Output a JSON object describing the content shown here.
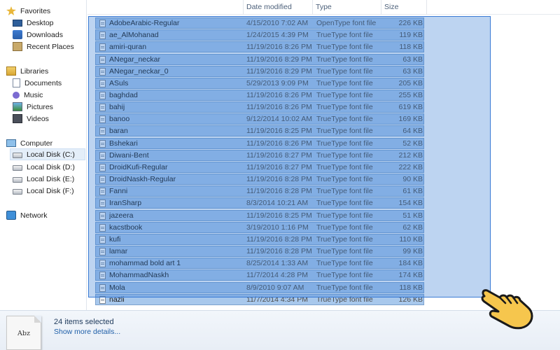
{
  "nav": {
    "favorites": {
      "label": "Favorites",
      "items": [
        "Desktop",
        "Downloads",
        "Recent Places"
      ]
    },
    "libraries": {
      "label": "Libraries",
      "items": [
        "Documents",
        "Music",
        "Pictures",
        "Videos"
      ]
    },
    "computer": {
      "label": "Computer",
      "items": [
        "Local Disk (C:)",
        "Local Disk (D:)",
        "Local Disk (E:)",
        "Local Disk (F:)"
      ],
      "selected": "Local Disk (C:)"
    },
    "network": {
      "label": "Network"
    }
  },
  "columns": {
    "name": "",
    "date": "Date modified",
    "type": "Type",
    "size": "Size"
  },
  "files": [
    {
      "name": "AdobeArabic-Regular",
      "date": "4/15/2010 7:02 AM",
      "type": "OpenType font file",
      "size": "226 KB",
      "selected": true
    },
    {
      "name": "ae_AlMohanad",
      "date": "1/24/2015 4:39 PM",
      "type": "TrueType font file",
      "size": "119 KB",
      "selected": true
    },
    {
      "name": "amiri-quran",
      "date": "11/19/2016 8:26 PM",
      "type": "TrueType font file",
      "size": "118 KB",
      "selected": true
    },
    {
      "name": "ANegar_neckar",
      "date": "11/19/2016 8:29 PM",
      "type": "TrueType font file",
      "size": "63 KB",
      "selected": true
    },
    {
      "name": "ANegar_neckar_0",
      "date": "11/19/2016 8:29 PM",
      "type": "TrueType font file",
      "size": "63 KB",
      "selected": true
    },
    {
      "name": "ASuls",
      "date": "5/29/2013 9:09 PM",
      "type": "TrueType font file",
      "size": "205 KB",
      "selected": true
    },
    {
      "name": "baghdad",
      "date": "11/19/2016 8:26 PM",
      "type": "TrueType font file",
      "size": "255 KB",
      "selected": true
    },
    {
      "name": "bahij",
      "date": "11/19/2016 8:26 PM",
      "type": "TrueType font file",
      "size": "619 KB",
      "selected": true
    },
    {
      "name": "banoo",
      "date": "9/12/2014 10:02 AM",
      "type": "TrueType font file",
      "size": "169 KB",
      "selected": true
    },
    {
      "name": "baran",
      "date": "11/19/2016 8:25 PM",
      "type": "TrueType font file",
      "size": "64 KB",
      "selected": true
    },
    {
      "name": "Bshekari",
      "date": "11/19/2016 8:26 PM",
      "type": "TrueType font file",
      "size": "52 KB",
      "selected": true
    },
    {
      "name": "Diwani-Bent",
      "date": "11/19/2016 8:27 PM",
      "type": "TrueType font file",
      "size": "212 KB",
      "selected": true
    },
    {
      "name": "DroidKufi-Regular",
      "date": "11/19/2016 8:27 PM",
      "type": "TrueType font file",
      "size": "222 KB",
      "selected": true
    },
    {
      "name": "DroidNaskh-Regular",
      "date": "11/19/2016 8:28 PM",
      "type": "TrueType font file",
      "size": "90 KB",
      "selected": true
    },
    {
      "name": "Fanni",
      "date": "11/19/2016 8:28 PM",
      "type": "TrueType font file",
      "size": "61 KB",
      "selected": true
    },
    {
      "name": "IranSharp",
      "date": "8/3/2014 10:21 AM",
      "type": "TrueType font file",
      "size": "154 KB",
      "selected": true
    },
    {
      "name": "jazeera",
      "date": "11/19/2016 8:25 PM",
      "type": "TrueType font file",
      "size": "51 KB",
      "selected": true
    },
    {
      "name": "kacstbook",
      "date": "3/19/2010 1:16 PM",
      "type": "TrueType font file",
      "size": "62 KB",
      "selected": true
    },
    {
      "name": "kufi",
      "date": "11/19/2016 8:28 PM",
      "type": "TrueType font file",
      "size": "110 KB",
      "selected": true
    },
    {
      "name": "lamar",
      "date": "11/19/2016 8:28 PM",
      "type": "TrueType font file",
      "size": "99 KB",
      "selected": true
    },
    {
      "name": "mohammad bold art 1",
      "date": "8/25/2014 1:33 AM",
      "type": "TrueType font file",
      "size": "184 KB",
      "selected": true
    },
    {
      "name": "MohammadNaskh",
      "date": "11/7/2014 4:28 PM",
      "type": "TrueType font file",
      "size": "174 KB",
      "selected": true
    },
    {
      "name": "Mola",
      "date": "8/9/2010 9:07 AM",
      "type": "TrueType font file",
      "size": "118 KB",
      "selected": true
    },
    {
      "name": "nazli",
      "date": "11/7/2014 4:34 PM",
      "type": "TrueType font file",
      "size": "126 KB",
      "selected": true
    }
  ],
  "details": {
    "selection_count": "24 items selected",
    "more_details": "Show more details...",
    "thumb_text": "Abz"
  },
  "colors": {
    "selection": "#a8c8ec",
    "marquee": "#3a7bd5",
    "link": "#1e5ea8"
  },
  "icons": {
    "favorites": "star-icon",
    "libraries": "library-icon",
    "computer": "computer-icon",
    "network": "network-icon",
    "file": "font-file-icon",
    "cursor": "hand-pointer-icon"
  }
}
